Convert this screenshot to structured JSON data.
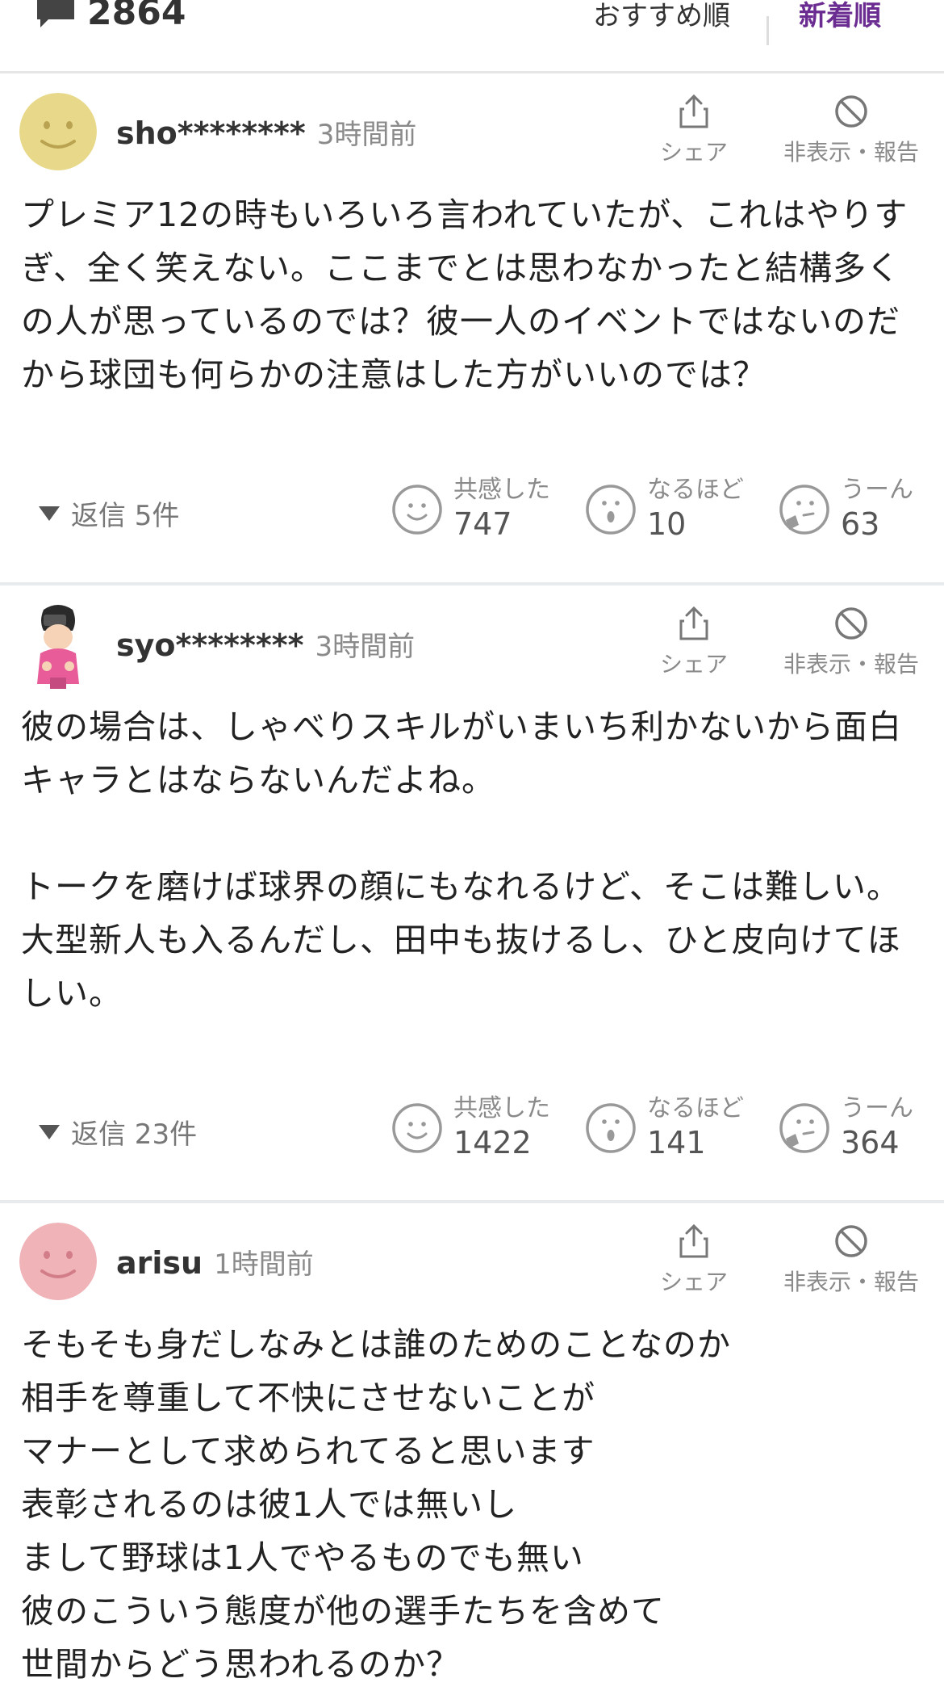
{
  "header": {
    "comment_count": "2864",
    "sort_recommended": "おすすめ順",
    "sort_newest": "新着順"
  },
  "actions": {
    "share": "シェア",
    "hide_report": "非表示・報告"
  },
  "reaction_labels": {
    "agree": "共感した",
    "insight": "なるほど",
    "hmm": "うーん"
  },
  "comments": [
    {
      "user": "sho********",
      "time": "3時間前",
      "body": "プレミア12の時もいろいろ言われていたが、これはやりすぎ、全く笑えない。ここまでとは思わなかったと結構多くの人が思っているのでは？彼一人のイベントではないのだから球団も何らかの注意はした方がいいのでは？",
      "replies": "返信 5件",
      "agree": "747",
      "insight": "10",
      "hmm": "63",
      "avatar_color": "#e8d98a"
    },
    {
      "user": "syo********",
      "time": "3時間前",
      "body": "彼の場合は、しゃべりスキルがいまいち利かないから面白キャラとはならないんだよね。\n\nトークを磨けば球界の顔にもなれるけど、そこは難しい。\n大型新人も入るんだし、田中も抜けるし、ひと皮向けてほしい。",
      "replies": "返信 23件",
      "agree": "1422",
      "insight": "141",
      "hmm": "364",
      "avatar_color": "#e85c9a"
    },
    {
      "user": "arisu",
      "time": "1時間前",
      "body": "そもそも身だしなみとは誰のためのことなのか\n相手を尊重して不快にさせないことが\nマナーとして求められてると思います\n表彰されるのは彼1人では無いし\nまして野球は1人でやるものでも無い\n彼のこういう態度が他の選手たちを含めて\n世間からどう思われるのか？",
      "avatar_color": "#efb3b8"
    }
  ]
}
